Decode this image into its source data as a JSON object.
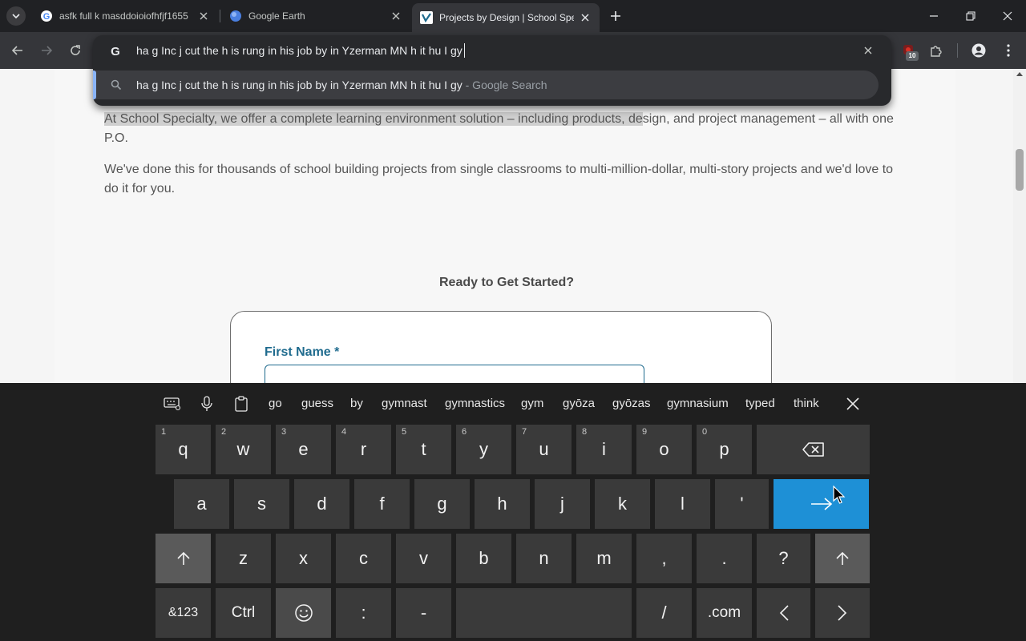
{
  "browser": {
    "tabs": [
      {
        "title": "asfk full k masddoioiofhfjf1655",
        "favicon": "google-g-icon",
        "active": false
      },
      {
        "title": "Google Earth",
        "favicon": "google-earth-icon",
        "active": false
      },
      {
        "title": "Projects by Design | School Spe",
        "favicon": "school-specialty-icon",
        "active": true
      }
    ],
    "omnibox": {
      "value": "ha g Inc j cut the h is rung in his job by in Yzerman MN h it hu I gy",
      "suggestion_query": "ha g Inc j cut the h is rung in his job by in Yzerman MN h it hu I gy",
      "suggestion_suffix": "- Google Search"
    },
    "extension_badge": "10"
  },
  "page": {
    "paragraph1_highlighted": "At School Specialty, we offer a complete learning environment solution – including products, de",
    "paragraph1_rest": "sign, and project management – all with one P.O.",
    "paragraph2": "We've done this for thousands of school building projects from single classrooms to multi-million-dollar, multi-story projects and we'd love to do it for you.",
    "ready_heading": "Ready to Get Started?",
    "first_name_label": "First Name *"
  },
  "keyboard": {
    "suggestions": [
      "go",
      "guess",
      "by",
      "gymnast",
      "gymnastics",
      "gym",
      "gyōza",
      "gyōzas",
      "gymnasium",
      "typed",
      "think"
    ],
    "row1": [
      {
        "label": "q",
        "num": "1"
      },
      {
        "label": "w",
        "num": "2"
      },
      {
        "label": "e",
        "num": "3"
      },
      {
        "label": "r",
        "num": "4"
      },
      {
        "label": "t",
        "num": "5"
      },
      {
        "label": "y",
        "num": "6"
      },
      {
        "label": "u",
        "num": "7"
      },
      {
        "label": "i",
        "num": "8"
      },
      {
        "label": "o",
        "num": "9"
      },
      {
        "label": "p",
        "num": "0"
      }
    ],
    "row2": [
      "a",
      "s",
      "d",
      "f",
      "g",
      "h",
      "j",
      "k",
      "l",
      "'"
    ],
    "row3": [
      "z",
      "x",
      "c",
      "v",
      "b",
      "n",
      "m",
      ",",
      ".",
      "?"
    ],
    "row4": {
      "symbols": "&123",
      "ctrl": "Ctrl",
      "colon": ":",
      "dash": "-",
      "slash": "/",
      "dotcom": ".com"
    }
  },
  "colors": {
    "enter_key": "#1e90d6",
    "form_label": "#1f6b8e",
    "omnibox_accent": "#8ab4f8"
  }
}
